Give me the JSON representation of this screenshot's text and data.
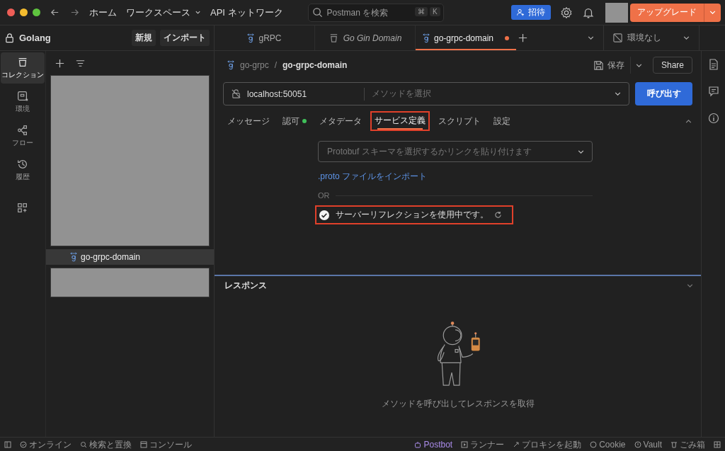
{
  "window": {
    "nav": [
      "ホーム",
      "ワークスペース",
      "API ネットワーク"
    ],
    "search_placeholder": "Postman を検索",
    "shortcut_keys": [
      "⌘",
      "K"
    ],
    "invite": "招待",
    "upgrade": "アップグレード"
  },
  "workspace": {
    "name": "Golang",
    "buttons": [
      "新規",
      "インポート"
    ]
  },
  "rail": [
    {
      "label": "コレクション",
      "kind": "collection",
      "selected": true
    },
    {
      "label": "環境",
      "kind": "environment",
      "selected": false
    },
    {
      "label": "フロー",
      "kind": "flow",
      "selected": false
    },
    {
      "label": "履歴",
      "kind": "history",
      "selected": false
    },
    {
      "kind": "apps",
      "selected": false
    }
  ],
  "sidebar": {
    "items": [
      {
        "label": "go-grpc-domain",
        "selected": true
      }
    ]
  },
  "request_tabs": [
    {
      "label": "gRPC",
      "kind": "grpc",
      "preview": false,
      "unsaved": false,
      "selected": false
    },
    {
      "label": "Go Gin Domain",
      "kind": "collection",
      "preview": true,
      "unsaved": false,
      "selected": false
    },
    {
      "label": "go-grpc-domain",
      "kind": "grpc",
      "preview": false,
      "unsaved": true,
      "selected": true
    }
  ],
  "environment": "環境なし",
  "breadcrumb": {
    "parent": "go-grpc",
    "separator": "/",
    "current": "go-grpc-domain"
  },
  "actions": {
    "save": "保存",
    "share": "Share"
  },
  "url": {
    "value": "localhost:50051",
    "method_placeholder": "メソッドを選択",
    "invoke": "呼び出す"
  },
  "tabs": [
    {
      "label": "メッセージ",
      "selected": false,
      "highlighted": false
    },
    {
      "label": "認可",
      "selected": false,
      "highlighted": false,
      "color": "#3fbf5a"
    },
    {
      "label": "メタデータ",
      "selected": false,
      "highlighted": false
    },
    {
      "label": "サービス定義",
      "selected": true,
      "highlighted": true
    },
    {
      "label": "スクリプト",
      "selected": false,
      "highlighted": false
    },
    {
      "label": "設定",
      "selected": false,
      "highlighted": false
    }
  ],
  "service": {
    "schema_placeholder": "Protobuf スキーマを選択するかリンクを貼り付けます",
    "import_link": ".proto ファイルをインポート",
    "or": "OR",
    "reflection": {
      "label": "サーバーリフレクションを使用中です。",
      "checked": true,
      "highlighted": true
    }
  },
  "response": {
    "title": "レスポンス",
    "empty_message": "メソッドを呼び出してレスポンスを取得"
  },
  "status_bar": {
    "left": [
      {
        "label": "オンライン",
        "kind": "check"
      },
      {
        "label": "検索と置換",
        "kind": "search"
      },
      {
        "label": "コンソール",
        "kind": "console"
      }
    ],
    "right": [
      {
        "label": "Postbot",
        "kind": "bot"
      },
      {
        "label": "ランナー",
        "kind": "play"
      },
      {
        "label": "プロキシを起動",
        "kind": "proxy"
      },
      {
        "label": "Cookie",
        "kind": "cookie"
      },
      {
        "label": "Vault",
        "kind": "vault"
      },
      {
        "label": "ごみ箱",
        "kind": "trash"
      }
    ]
  }
}
